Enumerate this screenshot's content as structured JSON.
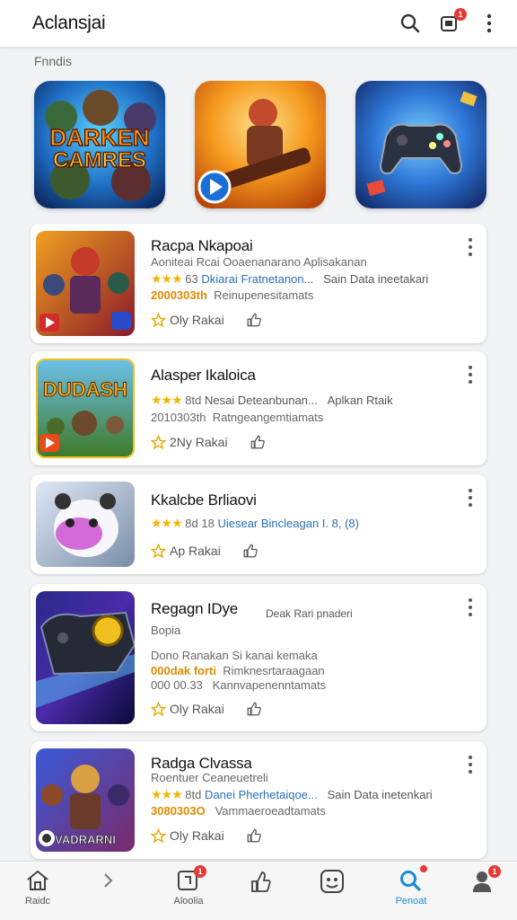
{
  "header": {
    "title": "Aclansjai",
    "icons": [
      "search-icon",
      "notifications-icon",
      "more-vert-icon"
    ],
    "notification_badge": "1"
  },
  "section": {
    "label": "Fnndis"
  },
  "featured": [
    {
      "name": "featured-tile-dark-games",
      "art_text": "DARKEN\nCAMRES"
    },
    {
      "name": "featured-tile-warrior-video",
      "icon": "play-icon"
    },
    {
      "name": "featured-tile-controller",
      "icon": "gamepad-icon"
    }
  ],
  "apps": [
    {
      "title": "Racpa Nkapoai",
      "line1": "Aoniteai Rcai Ooaenanarano Aplisakanan",
      "stars": "★★★",
      "rating": "63",
      "publisher": "Dkiarai Fratnetanon...",
      "category": "Sain Data ineetakari",
      "date": "2000303th",
      "date_extra": "Reinupenesitamats",
      "rate_label": "Oly Rakai"
    },
    {
      "title": "Alasper Ikaloica",
      "stars": "★★★",
      "rating": "8td",
      "publisher": "Nesai Deteanbunan...",
      "category": "Aplkan Rtaik",
      "date": "2010303th",
      "date_extra": "Ratngeangemtiamats",
      "rate_label": "2Ny Rakai"
    },
    {
      "title": "Kkalcbe Brliaovi",
      "stars": "★★★",
      "rating": "8d 18",
      "publisher": "Uiesear Bincleagan I. 8, (8)",
      "rate_label": "Ap Rakai"
    },
    {
      "title": "Regagn IDye",
      "subtitle": "Deak Rari pnaderi",
      "line1": "Bopia",
      "line2": "Dono Ranakan Si kanai kemaka",
      "highlight": "000dak forti",
      "line3_rest": "Rimknesrtaraagaan",
      "date": "000 00.33",
      "date_extra": "Kannvapenenntamats",
      "rate_label": "Oly Rakai"
    },
    {
      "title": "Radga Clvassa",
      "line1": "Roentuer Ceaneuetreli",
      "stars": "★★★",
      "rating": "8td",
      "publisher": "Danei Pherhetaiqoe...",
      "category": "Sain Data inetenkari",
      "date": "3080303O",
      "date_extra": "Vammaeroeadtamats",
      "rate_label": "Oly Rakai"
    }
  ],
  "bottom_nav": [
    {
      "label": "Raidc",
      "icon": "home-icon"
    },
    {
      "label": "",
      "icon": "chevron-right-icon"
    },
    {
      "label": "Aloolia",
      "icon": "inbox-icon",
      "badge": "1"
    },
    {
      "label": "",
      "icon": "thumb-icon"
    },
    {
      "label": "",
      "icon": "game-face-icon"
    },
    {
      "label": "Penoat",
      "icon": "search-active-icon",
      "active": true
    },
    {
      "label": "",
      "icon": "profile-icon",
      "badge": "1"
    }
  ],
  "colors": {
    "accent": "#1a8bd6",
    "star": "#f5b400",
    "badge": "#e53935"
  }
}
